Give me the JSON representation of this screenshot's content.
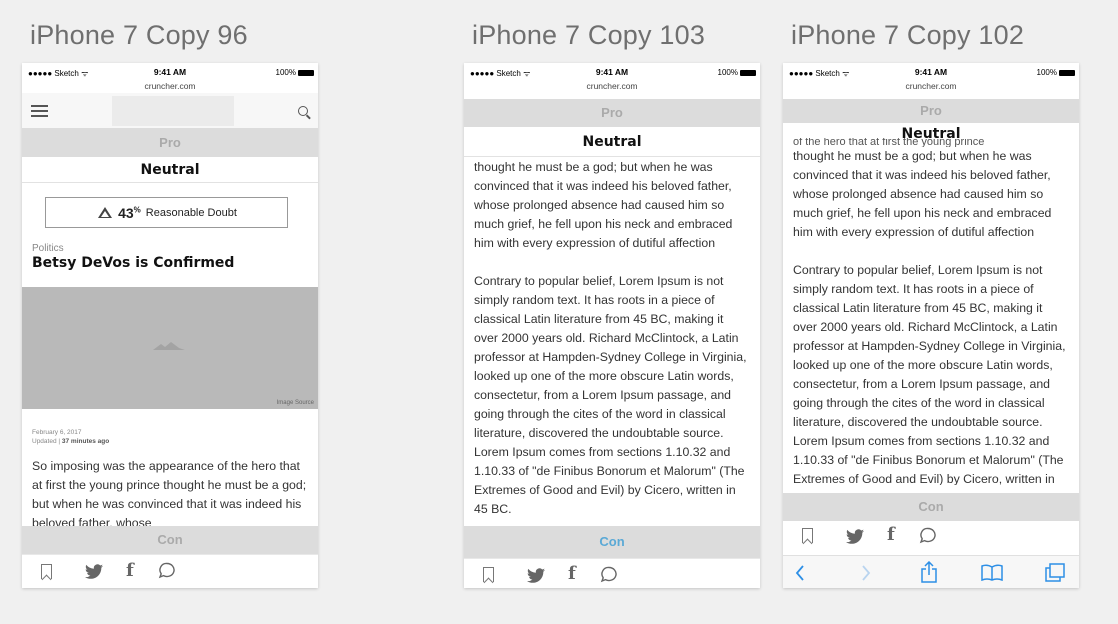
{
  "artboards": [
    {
      "title": "iPhone 7 Copy 96"
    },
    {
      "title": "iPhone 7 Copy 103"
    },
    {
      "title": "iPhone 7 Copy 102"
    }
  ],
  "status": {
    "carrier": "●●●●● Sketch ᯤ",
    "time": "9:41 AM",
    "battery": "100%"
  },
  "url": "cruncher.com",
  "bars": {
    "pro": "Pro",
    "neutral": "Neutral",
    "con": "Con"
  },
  "article": {
    "meter_percent": "43",
    "meter_percent_sign": "%",
    "meter_label": "Reasonable Doubt",
    "category": "Politics",
    "headline": "Betsy DeVos is Confirmed",
    "image_credit": "Image Source",
    "date": "February 6, 2017",
    "updated_prefix": "Updated |",
    "updated_time": "37 minutes ago",
    "excerpt": "So imposing was the appearance of the hero that at first the young prince thought he must be a god; but when he was convinced that it was indeed his beloved father, whose"
  },
  "body": {
    "lead_fragment": "of the hero that at first the young prince",
    "para1": "thought he must be a god; but when he was convinced that it was indeed his beloved father, whose prolonged absence had caused him so much grief, he fell upon his neck and embraced him with every expression of dutiful affection",
    "para2": "Contrary to popular belief, Lorem Ipsum is not simply random text. It has roots in a piece of classical Latin literature from 45 BC, making it over 2000 years old. Richard McClintock, a Latin professor at Hampden-Sydney College in Virginia, looked up one of the more obscure Latin words, consectetur, from a Lorem Ipsum passage, and going through the cites of the word in classical literature, discovered the undoubtable source. Lorem Ipsum comes from sections 1.10.32 and 1.10.33 of \"de Finibus Bonorum et Malorum\" (The Extremes of Good and Evil) by Cicero, written in 45 BC."
  },
  "colors": {
    "con_active": "#5aa9d6",
    "safari_accent": "#2d8fe6"
  }
}
